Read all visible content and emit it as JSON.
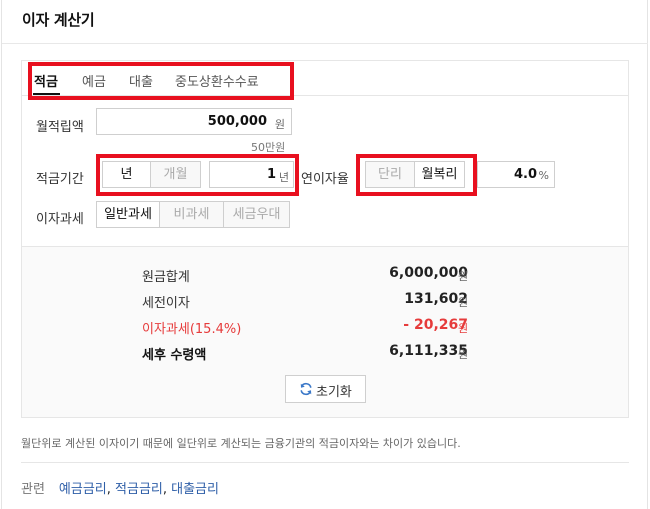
{
  "title": "이자 계산기",
  "tabs": [
    {
      "label": "적금",
      "active": true
    },
    {
      "label": "예금",
      "active": false
    },
    {
      "label": "대출",
      "active": false
    },
    {
      "label": "중도상환수수료",
      "active": false
    }
  ],
  "monthly": {
    "label": "월적립액",
    "value": "500,000",
    "unit": "원",
    "hint": "50만원"
  },
  "period": {
    "label": "적금기간",
    "opt_year": "년",
    "opt_month": "개월",
    "value": "1",
    "unit": "년"
  },
  "rate": {
    "label": "연이자율",
    "opt_simple": "단리",
    "opt_compound": "월복리",
    "value": "4.0",
    "unit": "%"
  },
  "tax": {
    "label": "이자과세",
    "opt_general": "일반과세",
    "opt_exempt": "비과세",
    "opt_preferential": "세금우대"
  },
  "results": [
    {
      "label": "원금합계",
      "value": "6,000,000",
      "unit": "원",
      "highlight": false
    },
    {
      "label": "세전이자",
      "value": "131,602",
      "unit": "원",
      "highlight": false
    },
    {
      "label": "이자과세(15.4%)",
      "value": "- 20,267",
      "unit": "원",
      "highlight": true
    },
    {
      "label": "세후 수령액",
      "value": "6,111,335",
      "unit": "원",
      "highlight": false
    }
  ],
  "reset_label": "초기화",
  "note": "월단위로 계산된 이자이기 때문에 일단위로 계산되는 금융기관의 적금이자와는 차이가 있습니다.",
  "related": {
    "label": "관련",
    "links": [
      "예금금리",
      "적금금리",
      "대출금리"
    ]
  },
  "colors": {
    "highlight_box": "#e8101f",
    "negative": "#e63b3b",
    "link": "#2f5fa8"
  }
}
